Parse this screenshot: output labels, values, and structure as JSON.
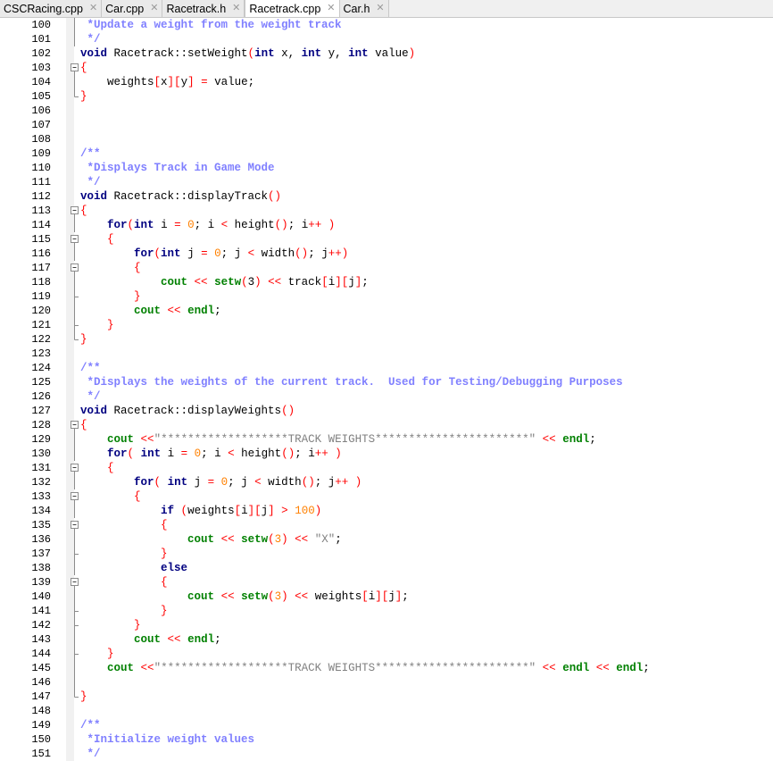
{
  "tabs": [
    {
      "label": "CSCRacing.cpp",
      "active": false
    },
    {
      "label": "Car.cpp",
      "active": false
    },
    {
      "label": "Racetrack.h",
      "active": false
    },
    {
      "label": "Racetrack.cpp",
      "active": true
    },
    {
      "label": "Car.h",
      "active": false
    }
  ],
  "close_glyph": "✕",
  "colors": {
    "keyword": "#000080",
    "cout_endl": "#008000",
    "number": "#ff8000",
    "operator": "#ff0000",
    "comment": "#8080ff",
    "string": "#808080"
  },
  "lines": [
    {
      "n": "100",
      "fold": "line",
      "tokens": [
        [
          "cm",
          " *Update a weight from the weight track"
        ]
      ]
    },
    {
      "n": "101",
      "fold": "line",
      "tokens": [
        [
          "cm",
          " */"
        ]
      ]
    },
    {
      "n": "102",
      "fold": "",
      "tokens": [
        [
          "kw",
          "void"
        ],
        [
          "plain",
          " Racetrack::setWeight"
        ],
        [
          "op",
          "("
        ],
        [
          "kw",
          "int"
        ],
        [
          "plain",
          " x, "
        ],
        [
          "kw",
          "int"
        ],
        [
          "plain",
          " y, "
        ],
        [
          "kw",
          "int"
        ],
        [
          "plain",
          " value"
        ],
        [
          "op",
          ")"
        ]
      ]
    },
    {
      "n": "103",
      "fold": "box",
      "tokens": [
        [
          "op",
          "{"
        ]
      ]
    },
    {
      "n": "104",
      "fold": "line",
      "tokens": [
        [
          "plain",
          "    weights"
        ],
        [
          "op",
          "["
        ],
        [
          "plain",
          "x"
        ],
        [
          "op",
          "]["
        ],
        [
          "plain",
          "y"
        ],
        [
          "op",
          "]"
        ],
        [
          "plain",
          " "
        ],
        [
          "op",
          "="
        ],
        [
          "plain",
          " value;"
        ]
      ]
    },
    {
      "n": "105",
      "fold": "end",
      "tokens": [
        [
          "op",
          "}"
        ]
      ]
    },
    {
      "n": "106",
      "fold": "",
      "tokens": []
    },
    {
      "n": "107",
      "fold": "",
      "tokens": []
    },
    {
      "n": "108",
      "fold": "",
      "tokens": []
    },
    {
      "n": "109",
      "fold": "",
      "tokens": [
        [
          "cm",
          "/**"
        ]
      ]
    },
    {
      "n": "110",
      "fold": "",
      "tokens": [
        [
          "cm",
          " *Displays Track in Game Mode"
        ]
      ]
    },
    {
      "n": "111",
      "fold": "",
      "tokens": [
        [
          "cm",
          " */"
        ]
      ]
    },
    {
      "n": "112",
      "fold": "",
      "tokens": [
        [
          "kw",
          "void"
        ],
        [
          "plain",
          " Racetrack::displayTrack"
        ],
        [
          "op",
          "()"
        ]
      ]
    },
    {
      "n": "113",
      "fold": "box",
      "tokens": [
        [
          "op",
          "{"
        ]
      ]
    },
    {
      "n": "114",
      "fold": "line",
      "tokens": [
        [
          "plain",
          "    "
        ],
        [
          "kw",
          "for"
        ],
        [
          "op",
          "("
        ],
        [
          "kw",
          "int"
        ],
        [
          "plain",
          " i "
        ],
        [
          "op",
          "="
        ],
        [
          "plain",
          " "
        ],
        [
          "num",
          "0"
        ],
        [
          "plain",
          "; i "
        ],
        [
          "op",
          "<"
        ],
        [
          "plain",
          " height"
        ],
        [
          "op",
          "()"
        ],
        [
          "plain",
          "; i"
        ],
        [
          "op",
          "++"
        ],
        [
          "plain",
          " "
        ],
        [
          "op",
          ")"
        ]
      ]
    },
    {
      "n": "115",
      "fold": "box",
      "tokens": [
        [
          "plain",
          "    "
        ],
        [
          "op",
          "{"
        ]
      ]
    },
    {
      "n": "116",
      "fold": "line",
      "tokens": [
        [
          "plain",
          "        "
        ],
        [
          "kw",
          "for"
        ],
        [
          "op",
          "("
        ],
        [
          "kw",
          "int"
        ],
        [
          "plain",
          " j "
        ],
        [
          "op",
          "="
        ],
        [
          "plain",
          " "
        ],
        [
          "num",
          "0"
        ],
        [
          "plain",
          "; j "
        ],
        [
          "op",
          "<"
        ],
        [
          "plain",
          " width"
        ],
        [
          "op",
          "()"
        ],
        [
          "plain",
          "; j"
        ],
        [
          "op",
          "++)"
        ]
      ]
    },
    {
      "n": "117",
      "fold": "box",
      "tokens": [
        [
          "plain",
          "        "
        ],
        [
          "op",
          "{"
        ]
      ]
    },
    {
      "n": "118",
      "fold": "line",
      "tokens": [
        [
          "plain",
          "            "
        ],
        [
          "io",
          "cout"
        ],
        [
          "plain",
          " "
        ],
        [
          "op",
          "<<"
        ],
        [
          "plain",
          " "
        ],
        [
          "io",
          "setw"
        ],
        [
          "op",
          "("
        ],
        [
          "plain",
          "3"
        ],
        [
          "op",
          ")"
        ],
        [
          "plain",
          " "
        ],
        [
          "op",
          "<<"
        ],
        [
          "plain",
          " track"
        ],
        [
          "op",
          "["
        ],
        [
          "plain",
          "i"
        ],
        [
          "op",
          "]["
        ],
        [
          "plain",
          "j"
        ],
        [
          "op",
          "]"
        ],
        [
          "plain",
          ";"
        ]
      ]
    },
    {
      "n": "119",
      "fold": "tick",
      "tokens": [
        [
          "plain",
          "        "
        ],
        [
          "op",
          "}"
        ]
      ]
    },
    {
      "n": "120",
      "fold": "line",
      "tokens": [
        [
          "plain",
          "        "
        ],
        [
          "io",
          "cout"
        ],
        [
          "plain",
          " "
        ],
        [
          "op",
          "<<"
        ],
        [
          "plain",
          " "
        ],
        [
          "io",
          "endl"
        ],
        [
          "plain",
          ";"
        ]
      ]
    },
    {
      "n": "121",
      "fold": "tick",
      "tokens": [
        [
          "plain",
          "    "
        ],
        [
          "op",
          "}"
        ]
      ]
    },
    {
      "n": "122",
      "fold": "end",
      "tokens": [
        [
          "op",
          "}"
        ]
      ]
    },
    {
      "n": "123",
      "fold": "",
      "tokens": []
    },
    {
      "n": "124",
      "fold": "",
      "tokens": [
        [
          "cm",
          "/**"
        ]
      ]
    },
    {
      "n": "125",
      "fold": "",
      "tokens": [
        [
          "cm",
          " *Displays the weights of the current track.  Used for Testing/Debugging Purposes"
        ]
      ]
    },
    {
      "n": "126",
      "fold": "",
      "tokens": [
        [
          "cm",
          " */"
        ]
      ]
    },
    {
      "n": "127",
      "fold": "",
      "tokens": [
        [
          "kw",
          "void"
        ],
        [
          "plain",
          " Racetrack::displayWeights"
        ],
        [
          "op",
          "()"
        ]
      ]
    },
    {
      "n": "128",
      "fold": "box",
      "tokens": [
        [
          "op",
          "{"
        ]
      ]
    },
    {
      "n": "129",
      "fold": "line",
      "tokens": [
        [
          "plain",
          "    "
        ],
        [
          "io",
          "cout"
        ],
        [
          "plain",
          " "
        ],
        [
          "op",
          "<<"
        ],
        [
          "str",
          "\"*******************TRACK WEIGHTS***********************\""
        ],
        [
          "plain",
          " "
        ],
        [
          "op",
          "<<"
        ],
        [
          "plain",
          " "
        ],
        [
          "io",
          "endl"
        ],
        [
          "plain",
          ";"
        ]
      ]
    },
    {
      "n": "130",
      "fold": "line",
      "tokens": [
        [
          "plain",
          "    "
        ],
        [
          "kw",
          "for"
        ],
        [
          "op",
          "("
        ],
        [
          "plain",
          " "
        ],
        [
          "kw",
          "int"
        ],
        [
          "plain",
          " i "
        ],
        [
          "op",
          "="
        ],
        [
          "plain",
          " "
        ],
        [
          "num",
          "0"
        ],
        [
          "plain",
          "; i "
        ],
        [
          "op",
          "<"
        ],
        [
          "plain",
          " height"
        ],
        [
          "op",
          "()"
        ],
        [
          "plain",
          "; i"
        ],
        [
          "op",
          "++"
        ],
        [
          "plain",
          " "
        ],
        [
          "op",
          ")"
        ]
      ]
    },
    {
      "n": "131",
      "fold": "box",
      "tokens": [
        [
          "plain",
          "    "
        ],
        [
          "op",
          "{"
        ]
      ]
    },
    {
      "n": "132",
      "fold": "line",
      "tokens": [
        [
          "plain",
          "        "
        ],
        [
          "kw",
          "for"
        ],
        [
          "op",
          "("
        ],
        [
          "plain",
          " "
        ],
        [
          "kw",
          "int"
        ],
        [
          "plain",
          " j "
        ],
        [
          "op",
          "="
        ],
        [
          "plain",
          " "
        ],
        [
          "num",
          "0"
        ],
        [
          "plain",
          "; j "
        ],
        [
          "op",
          "<"
        ],
        [
          "plain",
          " width"
        ],
        [
          "op",
          "()"
        ],
        [
          "plain",
          "; j"
        ],
        [
          "op",
          "++"
        ],
        [
          "plain",
          " "
        ],
        [
          "op",
          ")"
        ]
      ]
    },
    {
      "n": "133",
      "fold": "box",
      "tokens": [
        [
          "plain",
          "        "
        ],
        [
          "op",
          "{"
        ]
      ]
    },
    {
      "n": "134",
      "fold": "line",
      "tokens": [
        [
          "plain",
          "            "
        ],
        [
          "kw",
          "if"
        ],
        [
          "plain",
          " "
        ],
        [
          "op",
          "("
        ],
        [
          "plain",
          "weights"
        ],
        [
          "op",
          "["
        ],
        [
          "plain",
          "i"
        ],
        [
          "op",
          "]["
        ],
        [
          "plain",
          "j"
        ],
        [
          "op",
          "]"
        ],
        [
          "plain",
          " "
        ],
        [
          "op",
          ">"
        ],
        [
          "plain",
          " "
        ],
        [
          "num",
          "100"
        ],
        [
          "op",
          ")"
        ]
      ]
    },
    {
      "n": "135",
      "fold": "box",
      "tokens": [
        [
          "plain",
          "            "
        ],
        [
          "op",
          "{"
        ]
      ]
    },
    {
      "n": "136",
      "fold": "line",
      "tokens": [
        [
          "plain",
          "                "
        ],
        [
          "io",
          "cout"
        ],
        [
          "plain",
          " "
        ],
        [
          "op",
          "<<"
        ],
        [
          "plain",
          " "
        ],
        [
          "io",
          "setw"
        ],
        [
          "op",
          "("
        ],
        [
          "num",
          "3"
        ],
        [
          "op",
          ")"
        ],
        [
          "plain",
          " "
        ],
        [
          "op",
          "<<"
        ],
        [
          "plain",
          " "
        ],
        [
          "str",
          "\"X\""
        ],
        [
          "plain",
          ";"
        ]
      ]
    },
    {
      "n": "137",
      "fold": "tick",
      "tokens": [
        [
          "plain",
          "            "
        ],
        [
          "op",
          "}"
        ]
      ]
    },
    {
      "n": "138",
      "fold": "line",
      "tokens": [
        [
          "plain",
          "            "
        ],
        [
          "kw",
          "else"
        ]
      ]
    },
    {
      "n": "139",
      "fold": "box",
      "tokens": [
        [
          "plain",
          "            "
        ],
        [
          "op",
          "{"
        ]
      ]
    },
    {
      "n": "140",
      "fold": "line",
      "tokens": [
        [
          "plain",
          "                "
        ],
        [
          "io",
          "cout"
        ],
        [
          "plain",
          " "
        ],
        [
          "op",
          "<<"
        ],
        [
          "plain",
          " "
        ],
        [
          "io",
          "setw"
        ],
        [
          "op",
          "("
        ],
        [
          "num",
          "3"
        ],
        [
          "op",
          ")"
        ],
        [
          "plain",
          " "
        ],
        [
          "op",
          "<<"
        ],
        [
          "plain",
          " weights"
        ],
        [
          "op",
          "["
        ],
        [
          "plain",
          "i"
        ],
        [
          "op",
          "]["
        ],
        [
          "plain",
          "j"
        ],
        [
          "op",
          "]"
        ],
        [
          "plain",
          ";"
        ]
      ]
    },
    {
      "n": "141",
      "fold": "tick",
      "tokens": [
        [
          "plain",
          "            "
        ],
        [
          "op",
          "}"
        ]
      ]
    },
    {
      "n": "142",
      "fold": "tick",
      "tokens": [
        [
          "plain",
          "        "
        ],
        [
          "op",
          "}"
        ]
      ]
    },
    {
      "n": "143",
      "fold": "line",
      "tokens": [
        [
          "plain",
          "        "
        ],
        [
          "io",
          "cout"
        ],
        [
          "plain",
          " "
        ],
        [
          "op",
          "<<"
        ],
        [
          "plain",
          " "
        ],
        [
          "io",
          "endl"
        ],
        [
          "plain",
          ";"
        ]
      ]
    },
    {
      "n": "144",
      "fold": "tick",
      "tokens": [
        [
          "plain",
          "    "
        ],
        [
          "op",
          "}"
        ]
      ]
    },
    {
      "n": "145",
      "fold": "line",
      "tokens": [
        [
          "plain",
          "    "
        ],
        [
          "io",
          "cout"
        ],
        [
          "plain",
          " "
        ],
        [
          "op",
          "<<"
        ],
        [
          "str",
          "\"*******************TRACK WEIGHTS***********************\""
        ],
        [
          "plain",
          " "
        ],
        [
          "op",
          "<<"
        ],
        [
          "plain",
          " "
        ],
        [
          "io",
          "endl"
        ],
        [
          "plain",
          " "
        ],
        [
          "op",
          "<<"
        ],
        [
          "plain",
          " "
        ],
        [
          "io",
          "endl"
        ],
        [
          "plain",
          ";"
        ]
      ]
    },
    {
      "n": "146",
      "fold": "line",
      "tokens": []
    },
    {
      "n": "147",
      "fold": "end",
      "tokens": [
        [
          "op",
          "}"
        ]
      ]
    },
    {
      "n": "148",
      "fold": "",
      "tokens": []
    },
    {
      "n": "149",
      "fold": "",
      "tokens": [
        [
          "cm",
          "/**"
        ]
      ]
    },
    {
      "n": "150",
      "fold": "",
      "tokens": [
        [
          "cm",
          " *Initialize weight values"
        ]
      ]
    },
    {
      "n": "151",
      "fold": "",
      "tokens": [
        [
          "cm",
          " */"
        ]
      ]
    }
  ]
}
